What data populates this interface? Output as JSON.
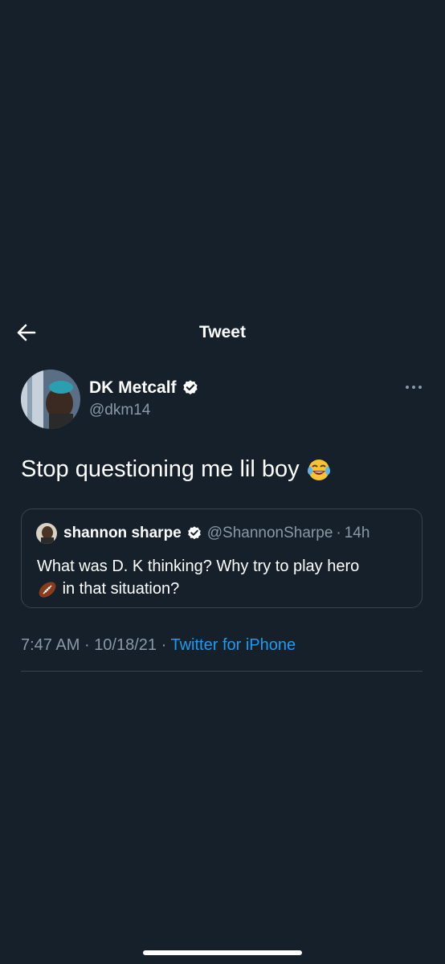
{
  "header": {
    "title": "Tweet",
    "back_icon": "arrow-left-icon"
  },
  "tweet": {
    "author_name": "DK Metcalf",
    "author_handle": "@dkm14",
    "text": "Stop questioning me lil boy",
    "emoji": "face-with-tears-of-joy",
    "verified": true,
    "time": "7:47 AM",
    "sep": "·",
    "date": "10/18/21",
    "source": "Twitter for iPhone"
  },
  "quote": {
    "author_name": "shannon sharpe",
    "author_handle": "@ShannonSharpe",
    "sep": "·",
    "age": "14h",
    "verified": true,
    "text": "What was D. K thinking? Why try to play hero",
    "text_line2": "in that situation?",
    "emoji": "american-football"
  },
  "colors": {
    "background": "#15202b",
    "text": "#ffffff",
    "secondary": "#8b98a5",
    "link": "#1d9bf0",
    "border": "#38444d"
  }
}
